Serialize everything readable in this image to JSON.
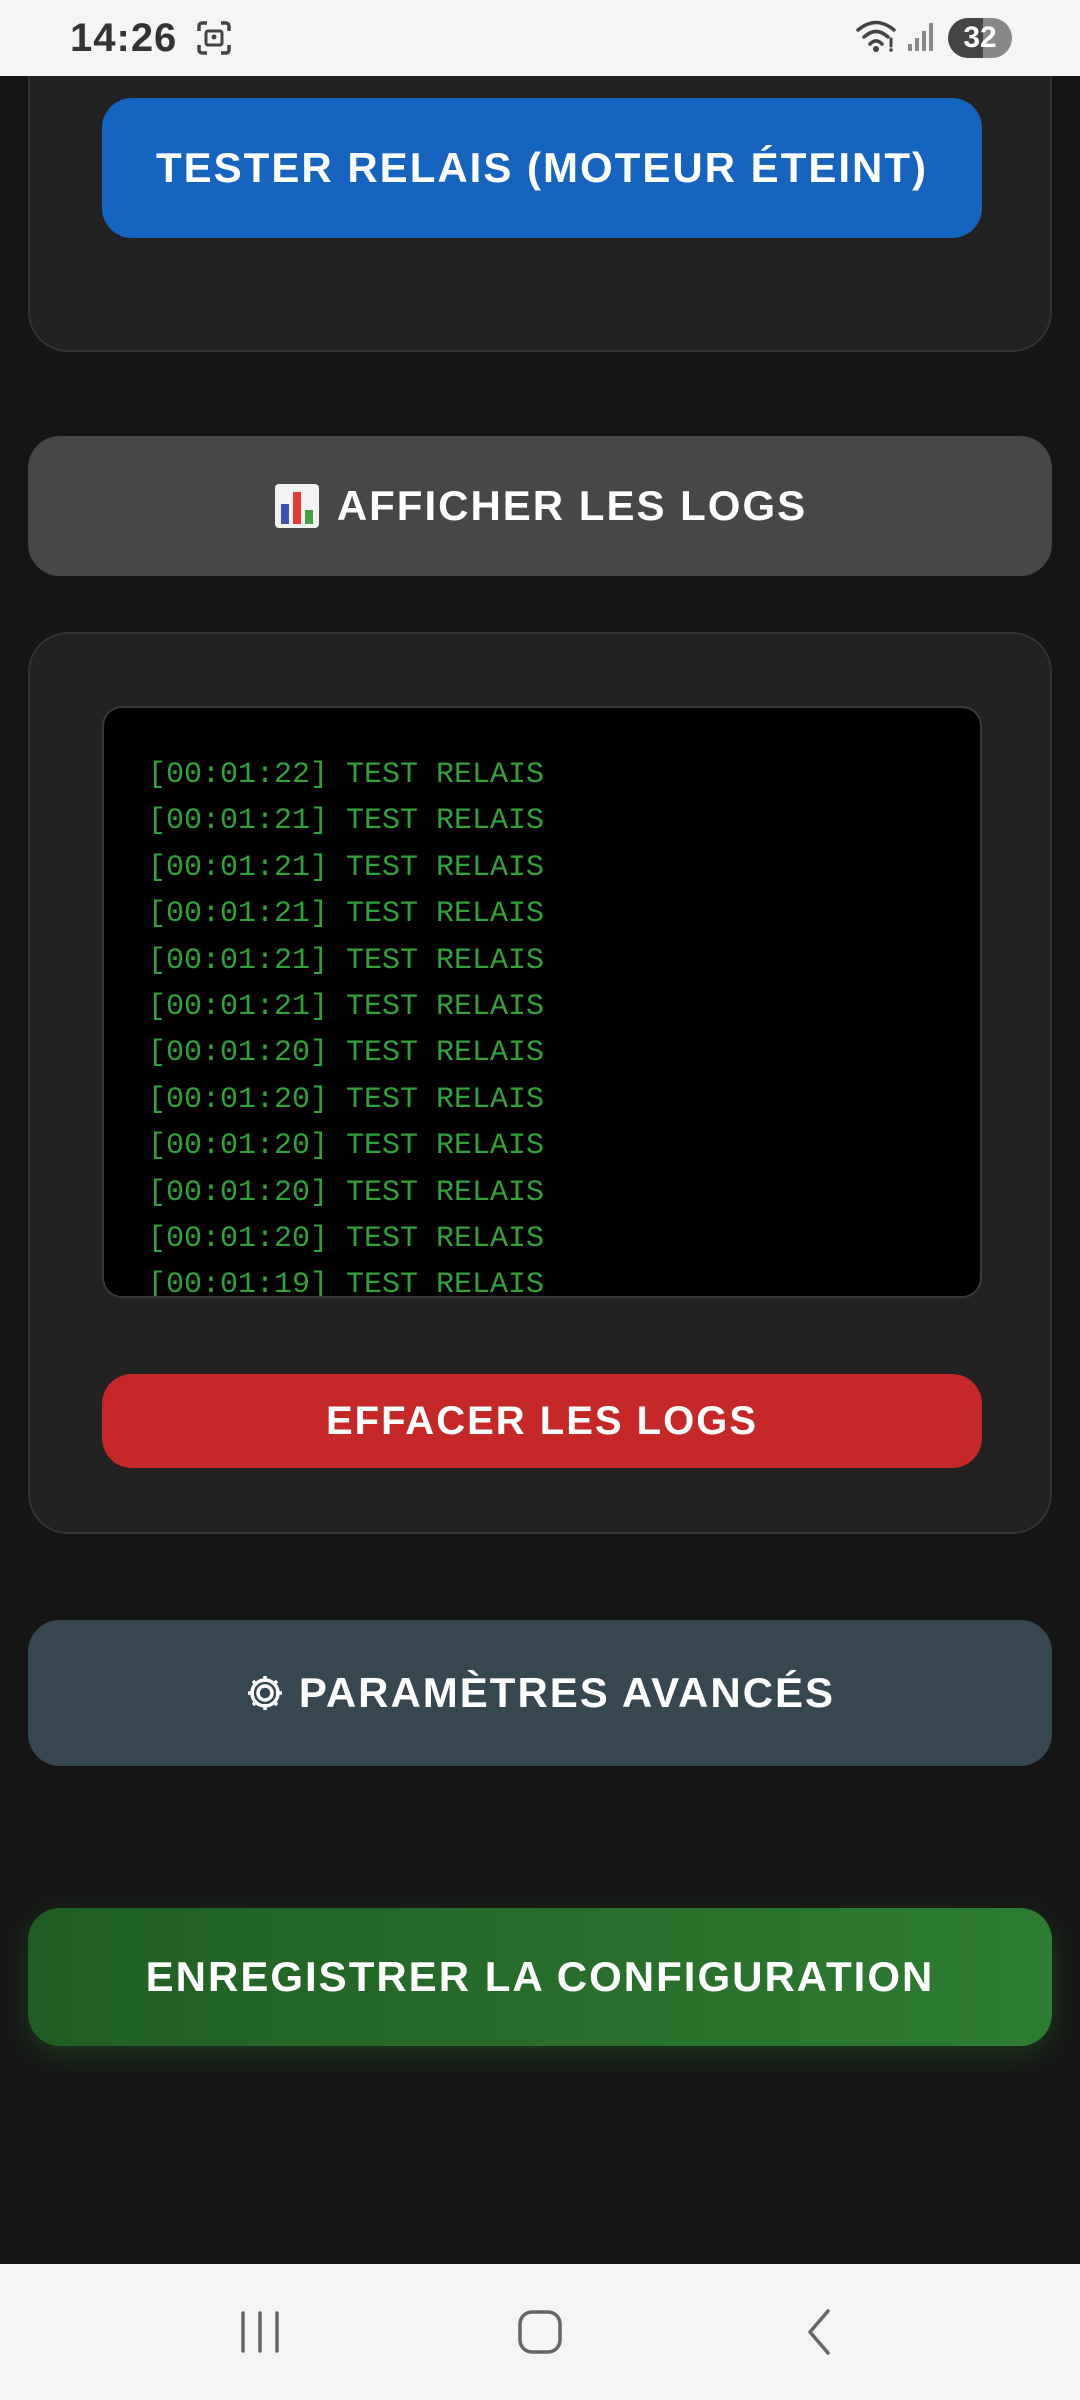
{
  "status_bar": {
    "time": "14:26",
    "battery": "32",
    "icons": [
      "screenshot-icon",
      "wifi-icon",
      "signal-icon"
    ]
  },
  "buttons": {
    "test_relay": "TESTER RELAIS (MOTEUR ÉTEINT)",
    "show_logs": "AFFICHER LES LOGS",
    "clear_logs": "EFFACER LES LOGS",
    "advanced_settings": "PARAMÈTRES AVANCÉS",
    "save_config": "ENREGISTRER LA CONFIGURATION"
  },
  "icons": {
    "show_logs": "bar-chart-icon",
    "advanced_settings": "gear-icon"
  },
  "logs": [
    "[00:01:22] TEST RELAIS",
    "[00:01:21] TEST RELAIS",
    "[00:01:21] TEST RELAIS",
    "[00:01:21] TEST RELAIS",
    "[00:01:21] TEST RELAIS",
    "[00:01:21] TEST RELAIS",
    "[00:01:20] TEST RELAIS",
    "[00:01:20] TEST RELAIS",
    "[00:01:20] TEST RELAIS",
    "[00:01:20] TEST RELAIS",
    "[00:01:20] TEST RELAIS",
    "[00:01:19] TEST RELAIS"
  ],
  "colors": {
    "test_button": "#1565c0",
    "show_logs_button": "#474747",
    "clear_button": "#c62828",
    "advanced_button": "#37474f",
    "save_button": "#2e7d32",
    "log_text": "#2fa33a"
  },
  "nav_bar": {
    "buttons": [
      "recent-apps-icon",
      "home-icon",
      "back-icon"
    ]
  }
}
